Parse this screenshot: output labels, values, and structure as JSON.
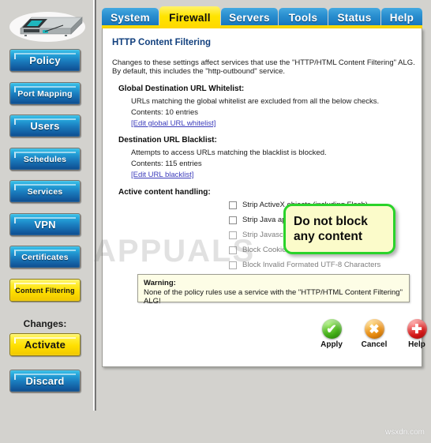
{
  "sidebar": {
    "device_icon": "firewall-appliance-image",
    "items": [
      {
        "label": "Policy",
        "style": "blue",
        "size": "f13"
      },
      {
        "label": "Port Mapping",
        "style": "blue",
        "size": "f11"
      },
      {
        "label": "Users",
        "style": "blue",
        "size": "f13"
      },
      {
        "label": "Schedules",
        "style": "blue",
        "size": "f11"
      },
      {
        "label": "Services",
        "style": "blue",
        "size": "f11"
      },
      {
        "label": "VPN",
        "style": "blue",
        "size": "f13"
      },
      {
        "label": "Certificates",
        "style": "blue",
        "size": "f11"
      },
      {
        "label": "Content Filtering",
        "style": "yellow",
        "size": "f9"
      }
    ],
    "changes_label": "Changes:",
    "changes": [
      {
        "label": "Activate",
        "style": "yellow",
        "size": "f13"
      },
      {
        "label": "Discard",
        "style": "blue",
        "size": "f13"
      }
    ]
  },
  "tabs": [
    {
      "label": "System",
      "active": false
    },
    {
      "label": "Firewall",
      "active": true
    },
    {
      "label": "Servers",
      "active": false
    },
    {
      "label": "Tools",
      "active": false
    },
    {
      "label": "Status",
      "active": false
    },
    {
      "label": "Help",
      "active": false
    }
  ],
  "page": {
    "title": "HTTP Content Filtering",
    "intro_line1": "Changes to these settings affect services that use the \"HTTP/HTML Content Filtering\" ALG.",
    "intro_line2": "By default, this includes the \"http-outbound\" service.",
    "whitelist": {
      "heading": "Global Destination URL Whitelist:",
      "desc": "URLs matching the global whitelist are excluded from all the below checks.",
      "contents": "Contents: 10 entries",
      "link": "[Edit global URL whitelist]"
    },
    "blacklist": {
      "heading": "Destination URL Blacklist:",
      "desc": "Attempts to access URLs matching the blacklist is blocked.",
      "contents": "Contents: 115 entries",
      "link": "[Edit URL blacklist]"
    },
    "active_content": {
      "heading": "Active content handling:",
      "options": [
        {
          "label": "Strip ActiveX objects (including Flash)",
          "checked": false,
          "dimmed": false
        },
        {
          "label": "Strip Java applets",
          "checked": false,
          "dimmed": false
        },
        {
          "label": "Strip Javascript/VBScript",
          "checked": false,
          "dimmed": true
        },
        {
          "label": "Block Cookies",
          "checked": false,
          "dimmed": true
        },
        {
          "label": "Block Invalid Formated UTF-8 Characters",
          "checked": false,
          "dimmed": true
        }
      ]
    },
    "warning": {
      "title": "Warning:",
      "text": "None of the policy rules use a service with the \"HTTP/HTML Content Filtering\" ALG!"
    },
    "actions": [
      {
        "label": "Apply",
        "icon": "check-circle-icon",
        "glyph": "✔"
      },
      {
        "label": "Cancel",
        "icon": "close-circle-icon",
        "glyph": "✖"
      },
      {
        "label": "Help",
        "icon": "plus-circle-icon",
        "glyph": "✚"
      }
    ]
  },
  "annotation": {
    "line1": "Do not block",
    "line2": "any content",
    "border_color": "#2ad32a",
    "fill_color": "#fbfbca"
  },
  "watermarks": {
    "center": "APPUALS",
    "bottom_right": "wsxdn.com"
  }
}
